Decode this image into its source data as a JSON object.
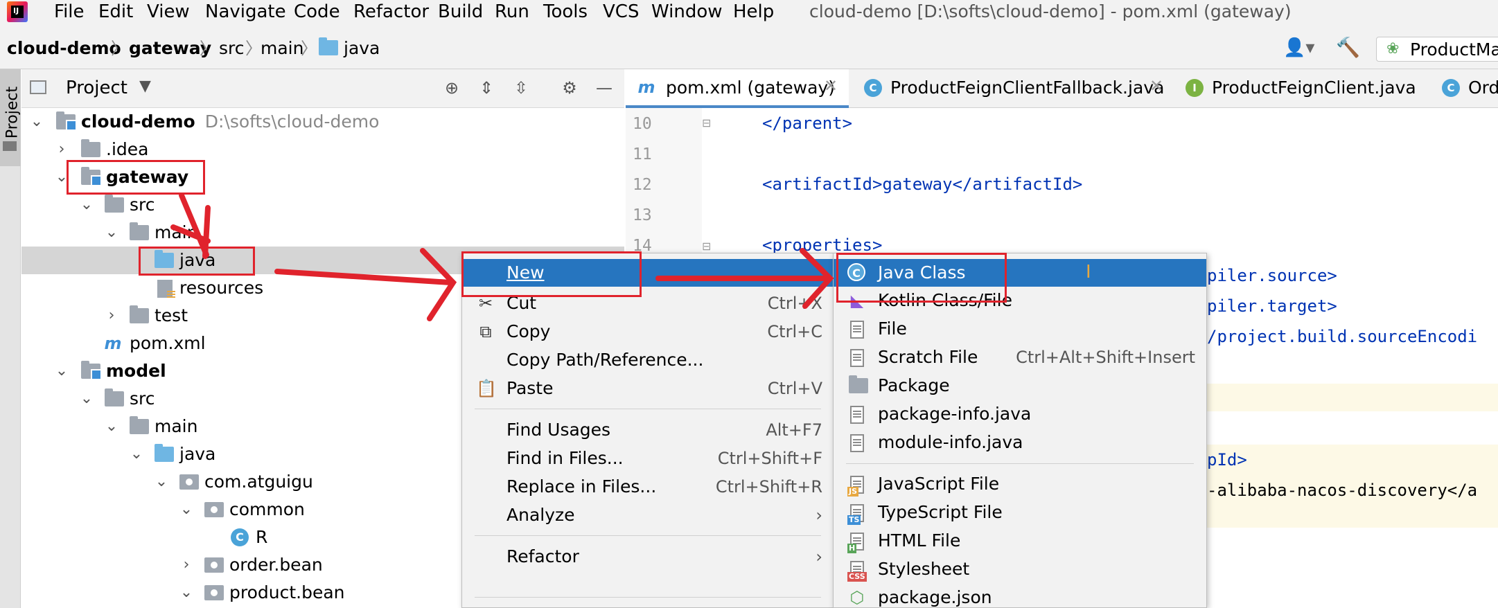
{
  "menubar": {
    "items": [
      "File",
      "Edit",
      "View",
      "Navigate",
      "Code",
      "Refactor",
      "Build",
      "Run",
      "Tools",
      "VCS",
      "Window",
      "Help"
    ],
    "title": "cloud-demo [D:\\softs\\cloud-demo] - pom.xml (gateway)"
  },
  "breadcrumb": [
    "cloud-demo",
    "gateway",
    "src",
    "main",
    "java"
  ],
  "run_config": "ProductMa",
  "sidestrip": {
    "label": "Project"
  },
  "project_panel": {
    "title": "Project"
  },
  "tree": [
    {
      "label": "cloud-demo",
      "path": "D:\\softs\\cloud-demo"
    },
    {
      "label": ".idea"
    },
    {
      "label": "gateway"
    },
    {
      "label": "src"
    },
    {
      "label": "main"
    },
    {
      "label": "java"
    },
    {
      "label": "resources"
    },
    {
      "label": "test"
    },
    {
      "label": "pom.xml"
    },
    {
      "label": "model"
    },
    {
      "label": "src"
    },
    {
      "label": "main"
    },
    {
      "label": "java"
    },
    {
      "label": "com.atguigu"
    },
    {
      "label": "common"
    },
    {
      "label": "R"
    },
    {
      "label": "order.bean"
    },
    {
      "label": "product.bean"
    }
  ],
  "tabs": [
    {
      "label": "pom.xml (gateway)",
      "icon": "m"
    },
    {
      "label": "ProductFeignClientFallback.java",
      "icon": "C"
    },
    {
      "label": "ProductFeignClient.java",
      "icon": "I"
    },
    {
      "label": "Ord",
      "icon": "C"
    }
  ],
  "editor": {
    "lines": [
      {
        "n": "10",
        "code": "</parent>"
      },
      {
        "n": "11",
        "code": ""
      },
      {
        "n": "12",
        "code": "<artifactId>gateway</artifactId>"
      },
      {
        "n": "13",
        "code": ""
      },
      {
        "n": "14",
        "code": "<properties>"
      }
    ],
    "fragments": [
      "piler.source>",
      "piler.target>",
      "/project.build.sourceEncodi",
      "pId>",
      "-alibaba-nacos-discovery</a"
    ]
  },
  "context_menu": [
    {
      "label": "New",
      "shortcut": ""
    },
    {
      "label": "Cut",
      "shortcut": "Ctrl+X"
    },
    {
      "label": "Copy",
      "shortcut": "Ctrl+C"
    },
    {
      "label": "Copy Path/Reference...",
      "shortcut": ""
    },
    {
      "label": "Paste",
      "shortcut": "Ctrl+V"
    },
    {
      "label": "Find Usages",
      "shortcut": "Alt+F7"
    },
    {
      "label": "Find in Files...",
      "shortcut": "Ctrl+Shift+F"
    },
    {
      "label": "Replace in Files...",
      "shortcut": "Ctrl+Shift+R"
    },
    {
      "label": "Analyze",
      "shortcut": ""
    },
    {
      "label": "Refactor",
      "shortcut": ""
    }
  ],
  "new_submenu": [
    {
      "label": "Java Class",
      "shortcut": ""
    },
    {
      "label": "Kotlin Class/File",
      "shortcut": ""
    },
    {
      "label": "File",
      "shortcut": ""
    },
    {
      "label": "Scratch File",
      "shortcut": "Ctrl+Alt+Shift+Insert"
    },
    {
      "label": "Package",
      "shortcut": ""
    },
    {
      "label": "package-info.java",
      "shortcut": ""
    },
    {
      "label": "module-info.java",
      "shortcut": ""
    },
    {
      "label": "JavaScript File",
      "shortcut": ""
    },
    {
      "label": "TypeScript File",
      "shortcut": ""
    },
    {
      "label": "HTML File",
      "shortcut": ""
    },
    {
      "label": "Stylesheet",
      "shortcut": ""
    },
    {
      "label": "package.json",
      "shortcut": ""
    }
  ],
  "colors": {
    "selection": "#2675bf",
    "annotation": "#e0232c"
  }
}
